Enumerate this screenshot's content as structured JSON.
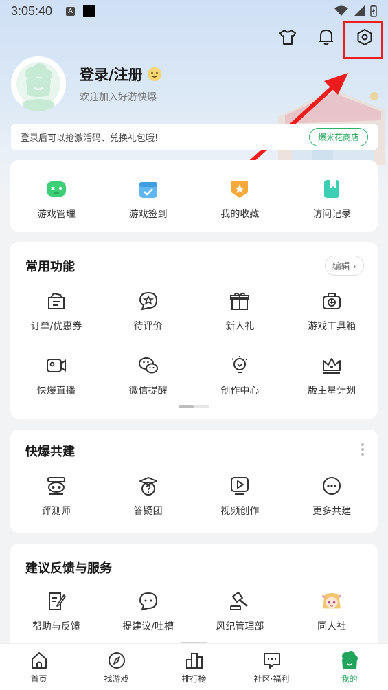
{
  "status_bar": {
    "time": "3:05:40",
    "a_icon_label": "A"
  },
  "header_icons": [
    "tshirt-icon",
    "bell-icon",
    "settings-icon"
  ],
  "profile": {
    "title": "登录/注册",
    "subtitle": "欢迎加入好游快爆"
  },
  "notice": {
    "text": "登录后可以抢激活码、兑换礼包哦!",
    "button": "爆米花商店"
  },
  "quick_actions": [
    {
      "label": "游戏管理",
      "icon": "gamepad-icon"
    },
    {
      "label": "游戏签到",
      "icon": "calendar-check-icon"
    },
    {
      "label": "我的收藏",
      "icon": "star-badge-icon"
    },
    {
      "label": "访问记录",
      "icon": "bookmark-icon"
    }
  ],
  "common": {
    "title": "常用功能",
    "edit": "编辑",
    "items": [
      {
        "label": "订单/优惠券",
        "icon": "order-coupon-icon"
      },
      {
        "label": "待评价",
        "icon": "star-comment-icon"
      },
      {
        "label": "新人礼",
        "icon": "gift-icon"
      },
      {
        "label": "游戏工具箱",
        "icon": "toolbox-icon"
      },
      {
        "label": "快爆直播",
        "icon": "video-camera-icon"
      },
      {
        "label": "微信提醒",
        "icon": "wechat-icon"
      },
      {
        "label": "创作中心",
        "icon": "lightbulb-icon"
      },
      {
        "label": "版主星计划",
        "icon": "crown-icon"
      }
    ]
  },
  "cobuild": {
    "title": "快爆共建",
    "items": [
      {
        "label": "评测师",
        "icon": "reviewer-icon"
      },
      {
        "label": "答疑团",
        "icon": "question-cap-icon"
      },
      {
        "label": "视频创作",
        "icon": "play-video-icon"
      },
      {
        "label": "更多共建",
        "icon": "more-icon"
      }
    ]
  },
  "service": {
    "title": "建议反馈与服务",
    "items": [
      {
        "label": "帮助与反馈",
        "icon": "feedback-note-icon"
      },
      {
        "label": "提建议/吐槽",
        "icon": "chat-bubble-icon"
      },
      {
        "label": "风纪管理部",
        "icon": "gavel-icon"
      },
      {
        "label": "同人社",
        "icon": "anime-avatar-icon"
      }
    ]
  },
  "tabbar": [
    {
      "label": "首页",
      "icon": "home-icon"
    },
    {
      "label": "找游戏",
      "icon": "compass-icon"
    },
    {
      "label": "排行榜",
      "icon": "ranking-icon"
    },
    {
      "label": "社区·福利",
      "icon": "community-icon"
    },
    {
      "label": "我的",
      "icon": "profile-icon"
    }
  ],
  "colors": {
    "accent": "#1fa45a",
    "highlight": "#ee1c1c"
  }
}
